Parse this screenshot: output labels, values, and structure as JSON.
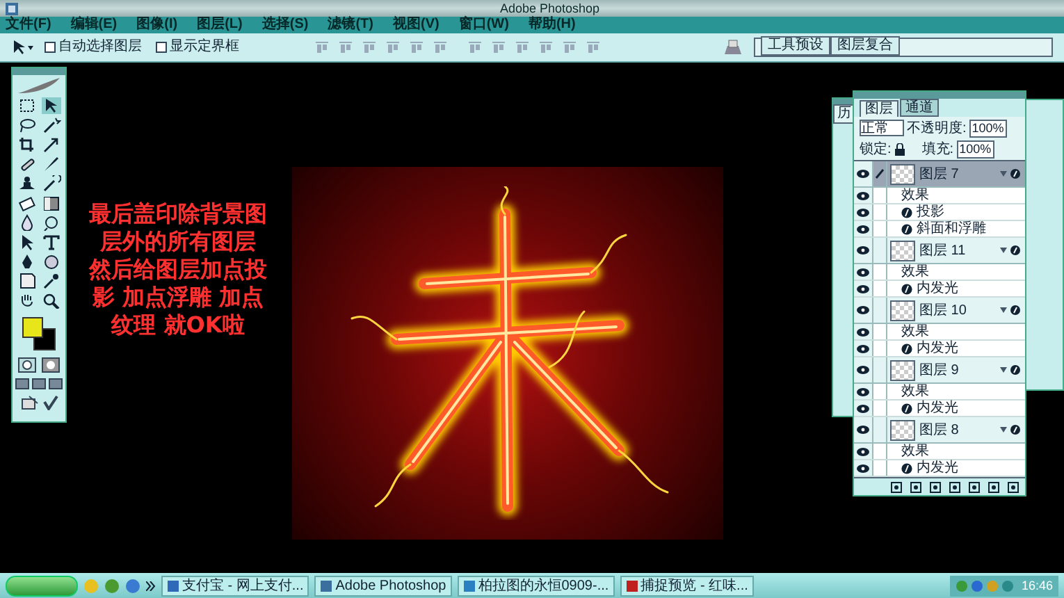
{
  "title_bar": {
    "title": "Adobe Photoshop"
  },
  "menu": [
    "文件(F)",
    "编辑(E)",
    "图像(I)",
    "图层(L)",
    "选择(S)",
    "滤镜(T)",
    "视图(V)",
    "窗口(W)",
    "帮助(H)"
  ],
  "options_bar": {
    "checkboxes": [
      {
        "label": "自动选择图层",
        "checked": false
      },
      {
        "label": "显示定界框",
        "checked": false
      }
    ],
    "palette_tabs": [
      "工具预设",
      "图层复合"
    ]
  },
  "caption_lines": [
    "最后盖印除背景图",
    "层外的所有图层",
    "然后给图层加点投",
    "影 加点浮雕 加点",
    "纹理 就OK啦"
  ],
  "back_panel": {
    "tab": "历"
  },
  "layers_panel": {
    "tabs": [
      {
        "label": "图层",
        "selected": true
      },
      {
        "label": "通道",
        "selected": false
      }
    ],
    "blend_mode": "正常",
    "opacity_label": "不透明度:",
    "opacity": "100%",
    "lock_label": "锁定:",
    "fill_label": "填充:",
    "fill": "100%",
    "layers": [
      {
        "name": "图层 7",
        "selected": true,
        "effects_label": "效果",
        "effects": [
          "投影",
          "斜面和浮雕"
        ]
      },
      {
        "name": "图层 11",
        "selected": false,
        "effects_label": "效果",
        "effects": [
          "内发光"
        ]
      },
      {
        "name": "图层 10",
        "selected": false,
        "effects_label": "效果",
        "effects": [
          "内发光"
        ]
      },
      {
        "name": "图层 9",
        "selected": false,
        "effects_label": "效果",
        "effects": [
          "内发光"
        ]
      },
      {
        "name": "图层 8",
        "selected": false,
        "effects_label": "效果",
        "effects": [
          "内发光"
        ]
      }
    ]
  },
  "taskbar": {
    "tasks": [
      "支付宝 - 网上支付...",
      "Adobe Photoshop",
      "柏拉图的永恒0909-...",
      "捕捉预览 - 红味..."
    ],
    "clock": "16:46"
  }
}
